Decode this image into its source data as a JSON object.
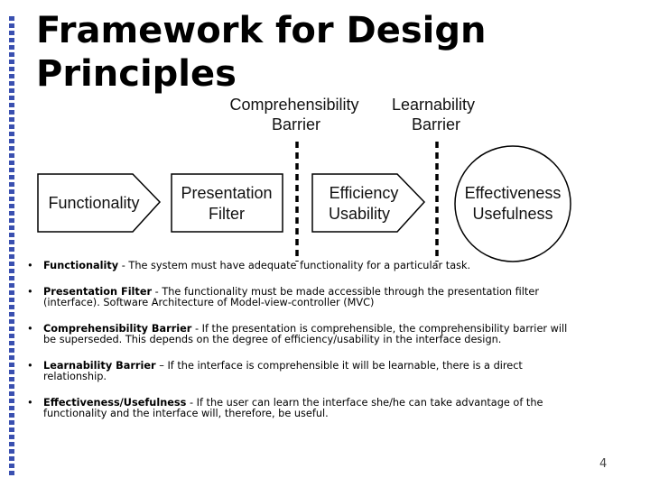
{
  "slide": {
    "title_line1": "Framework for Design",
    "title_line2": "Principles",
    "page_number": "4"
  },
  "diagram": {
    "barriers": [
      {
        "line1": "Comprehensibility",
        "line2": "Barrier"
      },
      {
        "line1": "Learnability",
        "line2": "Barrier"
      }
    ],
    "nodes": [
      {
        "line1": "Functionality",
        "line2": "",
        "shape": "pentagon-arrow"
      },
      {
        "line1": "Presentation",
        "line2": "Filter",
        "shape": "rectangle"
      },
      {
        "line1": "Efficiency",
        "line2": "Usability",
        "shape": "pentagon-arrow"
      },
      {
        "line1": "Effectiveness",
        "line2": "Usefulness",
        "shape": "circle"
      }
    ],
    "colors": {
      "stroke": "#000000",
      "sidebar_dots": "#3a50b0"
    }
  },
  "bullets": [
    {
      "term": "Functionality",
      "separator": " - ",
      "text": "The system must have adequate functionality for a particular task."
    },
    {
      "term": "Presentation Filter",
      "separator": " - ",
      "text": "The functionality must be made accessible through the presentation filter (interface).  Software Architecture of Model-view-controller (MVC)"
    },
    {
      "term": "Comprehensibility Barrier",
      "separator": " - ",
      "text": "If the presentation is comprehensible, the comprehensibility barrier will be superseded. This depends on the degree of efficiency/usability in the interface design."
    },
    {
      "term": "Learnability Barrier",
      "separator": " – ",
      "text": "If the interface is comprehensible it will be learnable, there is a direct relationship."
    },
    {
      "term": "Effectiveness/Usefulness",
      "separator": " - ",
      "text": "If the user can learn the interface she/he can take advantage of the functionality and the interface will, therefore, be useful."
    }
  ]
}
